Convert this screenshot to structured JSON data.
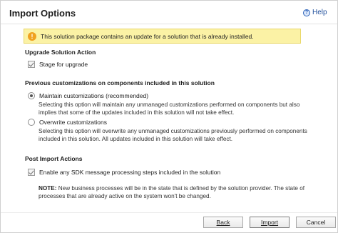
{
  "dialog": {
    "title": "Import Options",
    "help_label": "Help"
  },
  "warning": {
    "icon": "warning-icon",
    "text": "This solution package contains an update for a solution that is already installed."
  },
  "upgrade_section": {
    "title": "Upgrade Solution Action",
    "stage_label": "Stage for upgrade",
    "stage_checked": true
  },
  "customizations_section": {
    "title": "Previous customizations on components included in this solution",
    "maintain": {
      "label": "Maintain customizations (recommended)",
      "selected": true,
      "description": "Selecting this option will maintain any unmanaged customizations performed on components but also implies that some of the updates included in this solution will not take effect."
    },
    "overwrite": {
      "label": "Overwrite customizations",
      "selected": false,
      "description": "Selecting this option will overwrite any unmanaged customizations previously performed on components included in this solution. All updates included in this solution will take effect."
    }
  },
  "post_import_section": {
    "title": "Post Import Actions",
    "sdk_label": "Enable any SDK message processing steps included in the solution",
    "sdk_checked": true,
    "note_prefix": "NOTE:",
    "note_text": " New business processes will be in the state that is defined by the solution provider. The state of processes that are already active on the system won't be changed."
  },
  "buttons": {
    "back": "Back",
    "import": "Import",
    "cancel": "Cancel"
  }
}
